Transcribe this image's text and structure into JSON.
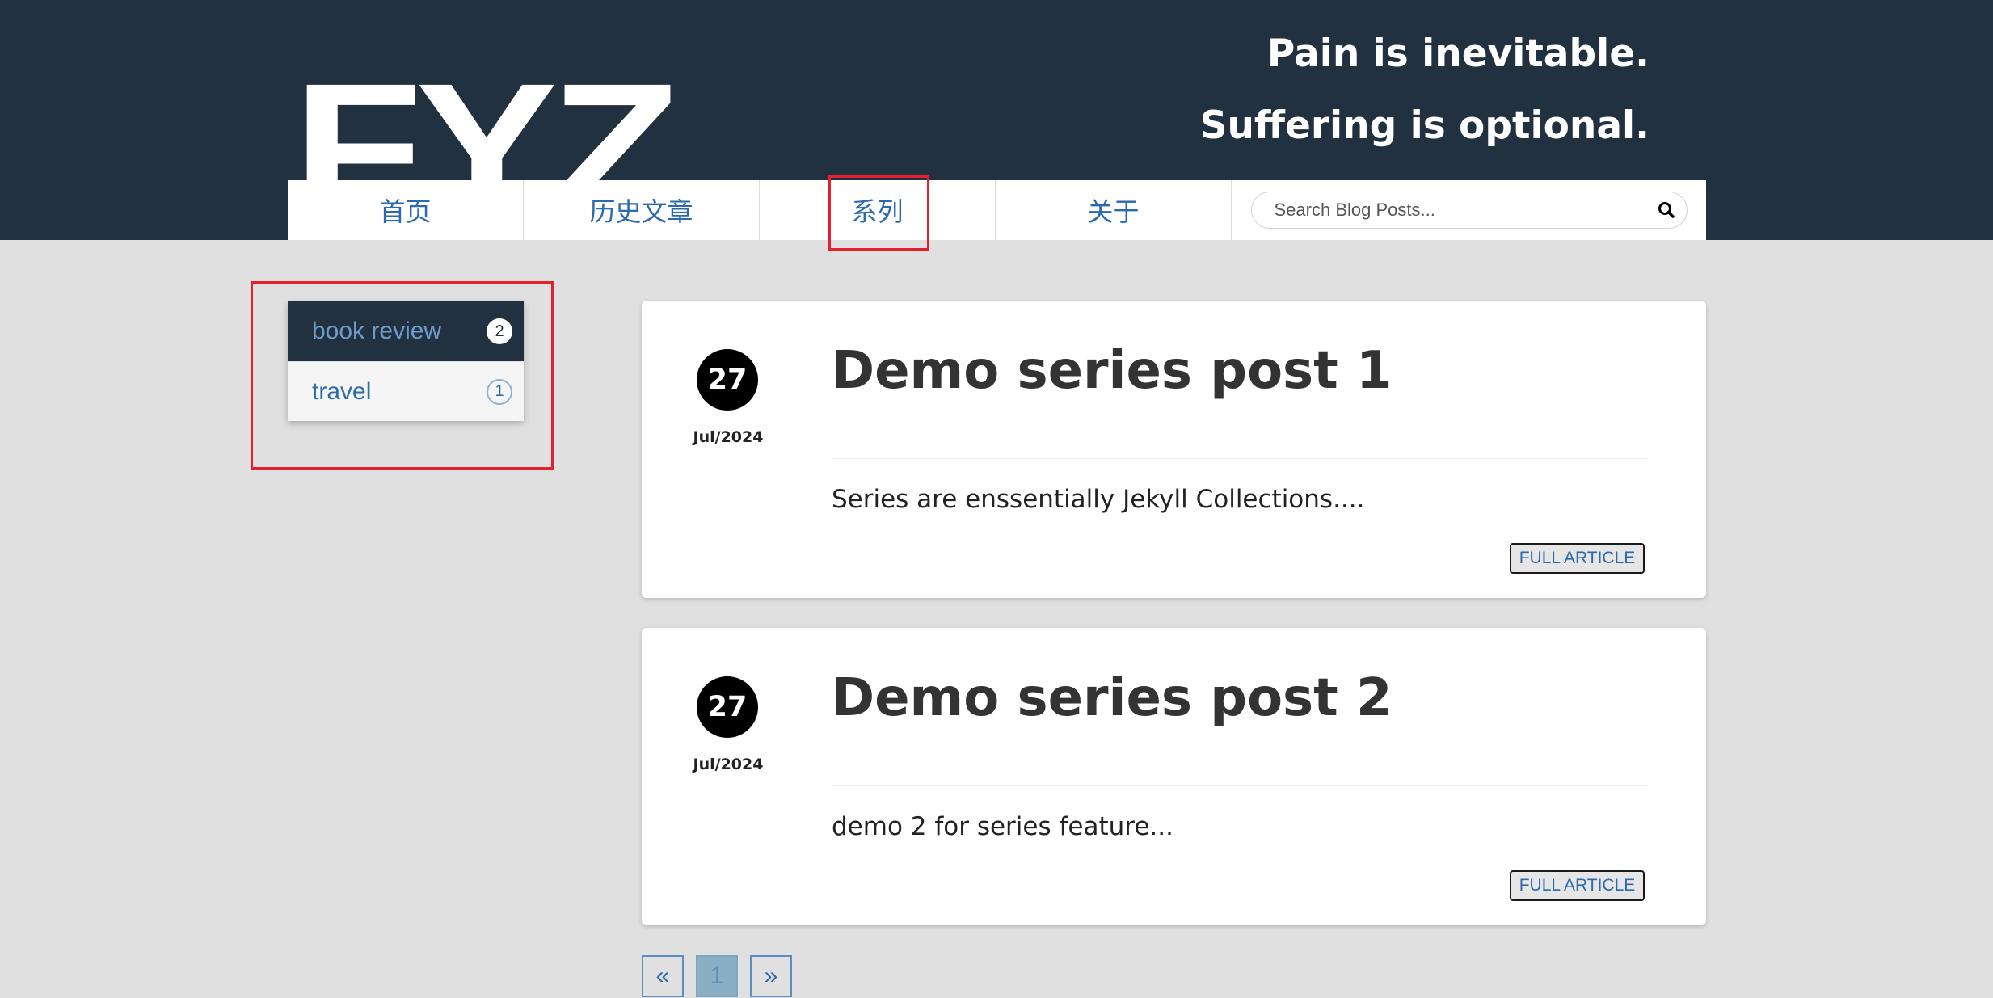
{
  "header": {
    "logo": "FYZ",
    "motto_line1": "Pain is inevitable.",
    "motto_line2": "Suffering is optional."
  },
  "nav": {
    "items": [
      {
        "label": "首页"
      },
      {
        "label": "历史文章"
      },
      {
        "label": "系列"
      },
      {
        "label": "关于"
      }
    ],
    "search_placeholder": "Search Blog Posts..."
  },
  "series": [
    {
      "name": "book review",
      "count": "2",
      "active": true
    },
    {
      "name": "travel",
      "count": "1",
      "active": false
    }
  ],
  "posts": [
    {
      "day": "27",
      "month": "Jul/2024",
      "title": "Demo series post 1",
      "excerpt": "Series are enssentially Jekyll Collections....",
      "button": "FULL ARTICLE"
    },
    {
      "day": "27",
      "month": "Jul/2024",
      "title": "Demo series post 2",
      "excerpt": "demo 2 for series feature...",
      "button": "FULL ARTICLE"
    }
  ],
  "pagination": {
    "prev": "«",
    "current": "1",
    "next": "»"
  },
  "colors": {
    "header_bg": "#213140",
    "link": "#2a6aad",
    "highlight_box": "#e5202e",
    "page_bg": "#e0e0e0"
  }
}
